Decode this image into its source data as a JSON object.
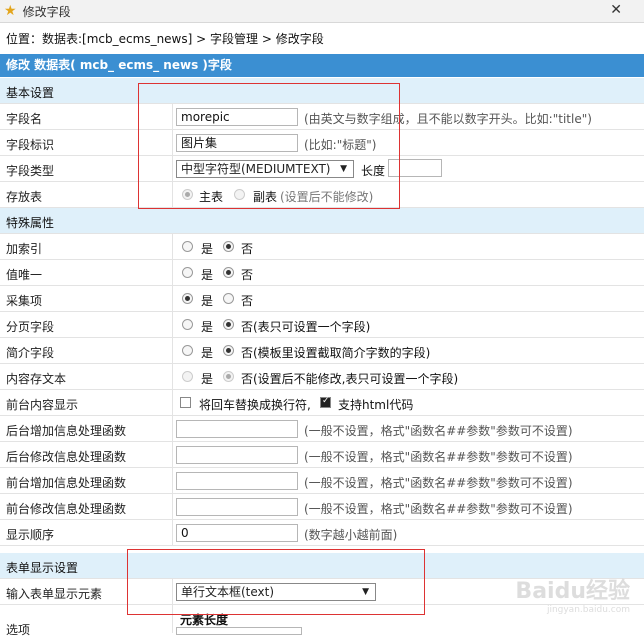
{
  "window": {
    "title": "修改字段"
  },
  "breadcrumb": {
    "prefix": "位置：",
    "table": "数据表:[mcb_ecms_news]",
    "sep1": " > ",
    "manage": "字段管理",
    "sep2": " > ",
    "edit": "修改字段"
  },
  "header": {
    "title": "修改 数据表( mcb_ ecms_ news )字段"
  },
  "sections": {
    "basic": "基本设置",
    "special": "特殊属性",
    "display": "表单显示设置"
  },
  "fields": {
    "name": {
      "label": "字段名",
      "value": "morepic",
      "hint": "(由英文与数字组成，且不能以数字开头。比如:\"title\")"
    },
    "ident": {
      "label": "字段标识",
      "value": "图片集",
      "hint": "(比如:\"标题\")"
    },
    "type": {
      "label": "字段类型",
      "selected": "中型字符型(MEDIUMTEXT)",
      "length_label": "长度",
      "length_value": ""
    },
    "store": {
      "label": "存放表",
      "main": "主表",
      "sub": "副表",
      "hint": "(设置后不能修改)"
    },
    "index": {
      "label": "加索引",
      "yes": "是",
      "no": "否"
    },
    "unique": {
      "label": "值唯一",
      "yes": "是",
      "no": "否"
    },
    "collect": {
      "label": "采集项",
      "yes": "是",
      "no": "否"
    },
    "paging": {
      "label": "分页字段",
      "yes": "是",
      "no": "否(表只可设置一个字段)"
    },
    "intro": {
      "label": "简介字段",
      "yes": "是",
      "no": "否(模板里设置截取简介字数的字段)"
    },
    "savetxt": {
      "label": "内容存文本",
      "yes": "是",
      "no": "否(设置后不能修改,表只可设置一个字段)"
    },
    "frontshow": {
      "label": "前台内容显示",
      "opt1": "将回车替换成换行符,",
      "opt2": "支持html代码"
    },
    "backadd": {
      "label": "后台增加信息处理函数",
      "value": "",
      "hint": "(一般不设置，格式\"函数名##参数\"参数可不设置)"
    },
    "backedit": {
      "label": "后台修改信息处理函数",
      "value": "",
      "hint": "(一般不设置，格式\"函数名##参数\"参数可不设置)"
    },
    "frontadd": {
      "label": "前台增加信息处理函数",
      "value": "",
      "hint": "(一般不设置，格式\"函数名##参数\"参数可不设置)"
    },
    "frontedit": {
      "label": "前台修改信息处理函数",
      "value": "",
      "hint": "(一般不设置，格式\"函数名##参数\"参数可不设置)"
    },
    "order": {
      "label": "显示顺序",
      "value": "0",
      "hint": "(数字越小越前面)"
    },
    "element": {
      "label": "输入表单显示元素",
      "selected": "单行文本框(text)"
    },
    "options": {
      "label": "选项",
      "sub_label": "元素长度"
    }
  },
  "watermark": {
    "text": "Baidu经验",
    "sub": "jingyan.baidu.com"
  }
}
